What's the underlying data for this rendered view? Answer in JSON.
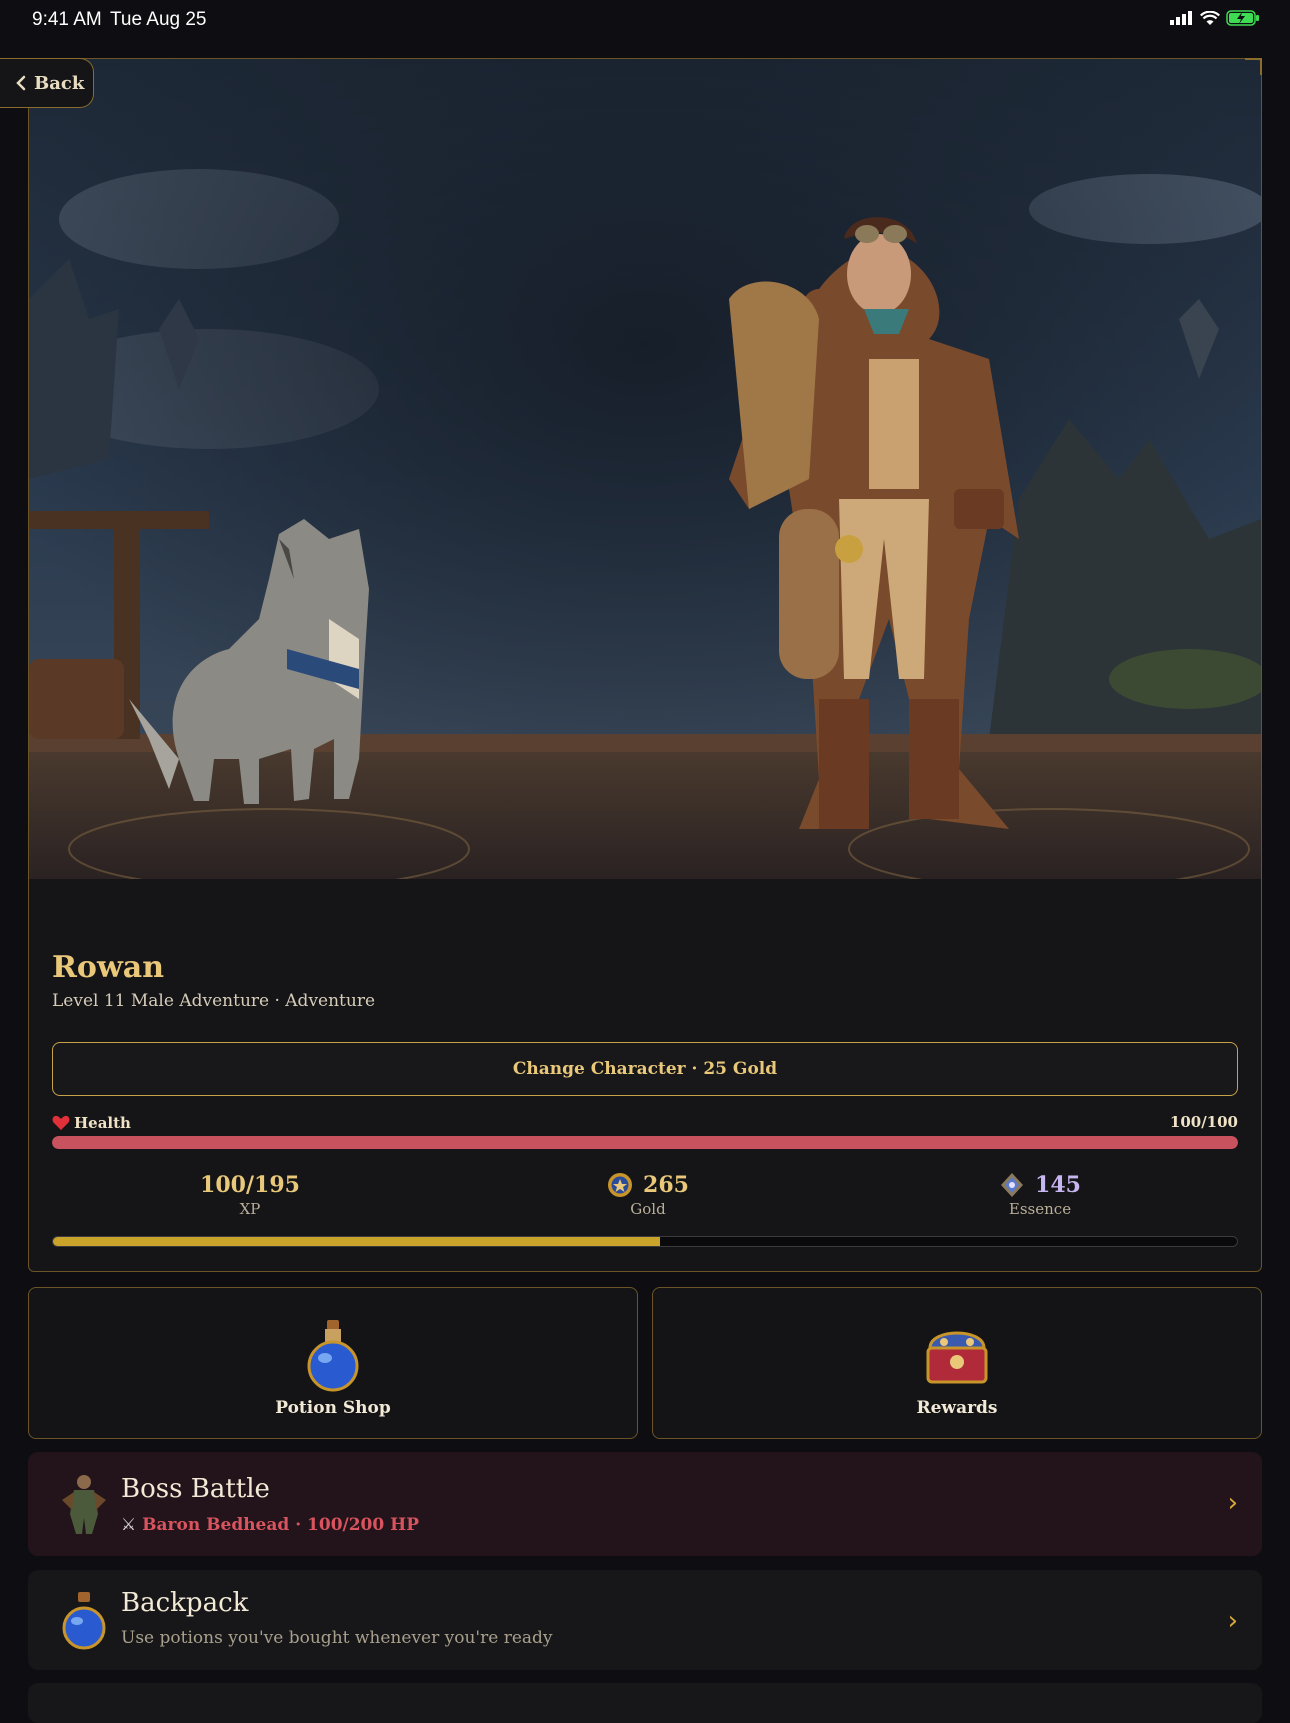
{
  "status": {
    "time": "9:41 AM",
    "date": "Tue Aug 25"
  },
  "nav": {
    "back_label": "Back"
  },
  "character": {
    "name": "Rowan",
    "subtitle": "Level 11 Male Adventure · Adventure",
    "change_label": "Change Character · 25 Gold"
  },
  "health": {
    "label": "Health",
    "value_text": "100/100",
    "current": 100,
    "max": 100
  },
  "stats": {
    "xp": {
      "value": "100/195",
      "label": "XP",
      "progress": 0.513
    },
    "gold": {
      "value": "265",
      "label": "Gold"
    },
    "essence": {
      "value": "145",
      "label": "Essence"
    }
  },
  "tiles": {
    "potion_shop": "Potion Shop",
    "rewards": "Rewards"
  },
  "boss": {
    "title": "Boss Battle",
    "detail": "Baron Bedhead · 100/200 HP"
  },
  "backpack": {
    "title": "Backpack",
    "subtitle": "Use potions you've bought whenever you're ready"
  },
  "colors": {
    "gold_accent": "#e9c87a",
    "health": "#c9525f",
    "xp": "#c9a32a",
    "essence": "#c7b6f0"
  },
  "icons": [
    "back-chevron-icon",
    "heart-icon",
    "gold-coin-icon",
    "essence-gem-icon",
    "potion-icon",
    "treasure-chest-icon",
    "boss-icon",
    "chevron-right-icon"
  ]
}
